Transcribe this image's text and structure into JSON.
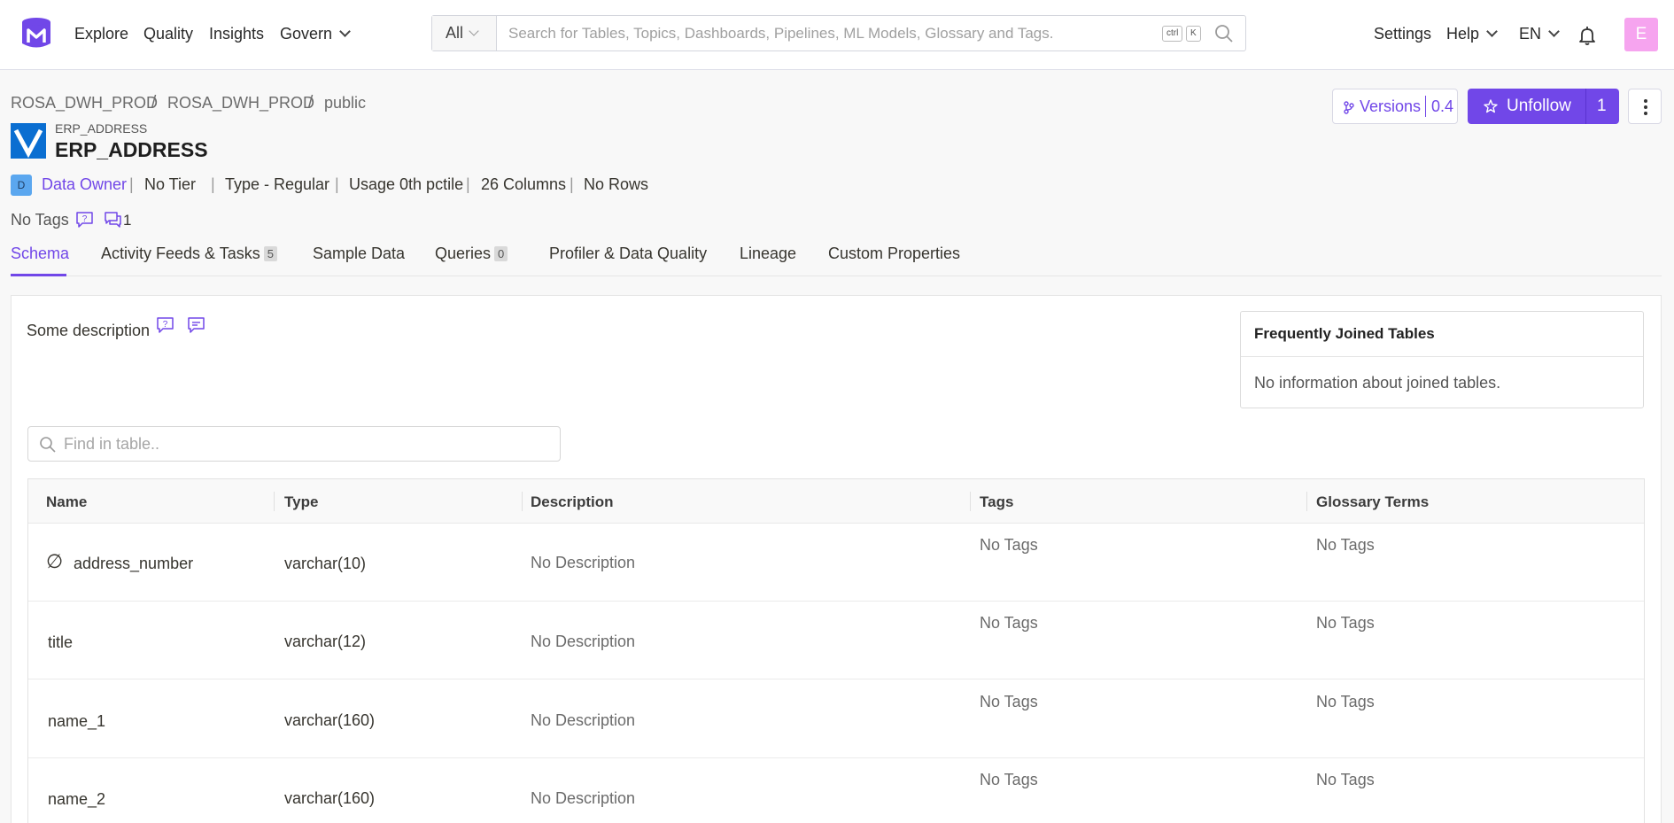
{
  "nav": {
    "links": [
      "Explore",
      "Quality",
      "Insights",
      "Govern"
    ],
    "search_filter": "All",
    "search_placeholder": "Search for Tables, Topics, Dashboards, Pipelines, ML Models, Glossary and Tags.",
    "kbd_ctrl": "ctrl",
    "kbd_k": "K",
    "settings": "Settings",
    "help": "Help",
    "language": "EN",
    "user_initial": "E"
  },
  "breadcrumb": [
    "ROSA_DWH_PROD",
    "ROSA_DWH_PROD",
    "public"
  ],
  "entity": {
    "subtitle": "ERP_ADDRESS",
    "title": "ERP_ADDRESS",
    "versions_label": "Versions",
    "version": "0.4",
    "follow_label": "Unfollow",
    "follow_count": "1"
  },
  "meta": {
    "owner_initial": "D",
    "owner": "Data Owner",
    "tier": "No Tier",
    "type": "Type -  Regular",
    "usage": "Usage 0th pctile",
    "columns": "26 Columns",
    "rows": "No Rows",
    "tags": "No Tags",
    "thread_count": "1"
  },
  "tabs": [
    {
      "label": "Schema",
      "count": ""
    },
    {
      "label": "Activity Feeds & Tasks",
      "count": "5"
    },
    {
      "label": "Sample Data",
      "count": ""
    },
    {
      "label": "Queries",
      "count": "0"
    },
    {
      "label": "Profiler & Data Quality",
      "count": ""
    },
    {
      "label": "Lineage",
      "count": ""
    },
    {
      "label": "Custom Properties",
      "count": ""
    }
  ],
  "schema": {
    "description": "Some description",
    "joined_title": "Frequently Joined Tables",
    "joined_text": "No information about joined tables.",
    "find_placeholder": "Find in table..",
    "columns": [
      "Name",
      "Type",
      "Description",
      "Tags",
      "Glossary Terms"
    ],
    "rows": [
      {
        "name": "address_number",
        "type": "varchar(10)",
        "description": "No Description",
        "tags": "No Tags",
        "glossary": "No Tags",
        "null_icon": "∅"
      },
      {
        "name": "title",
        "type": "varchar(12)",
        "description": "No Description",
        "tags": "No Tags",
        "glossary": "No Tags",
        "null_icon": ""
      },
      {
        "name": "name_1",
        "type": "varchar(160)",
        "description": "No Description",
        "tags": "No Tags",
        "glossary": "No Tags",
        "null_icon": ""
      },
      {
        "name": "name_2",
        "type": "varchar(160)",
        "description": "No Description",
        "tags": "No Tags",
        "glossary": "No Tags",
        "null_icon": ""
      }
    ]
  },
  "colors": {
    "accent": "#7147e8",
    "entity_icon": "#0a6ed1",
    "avatar": "#f6a4ef"
  }
}
